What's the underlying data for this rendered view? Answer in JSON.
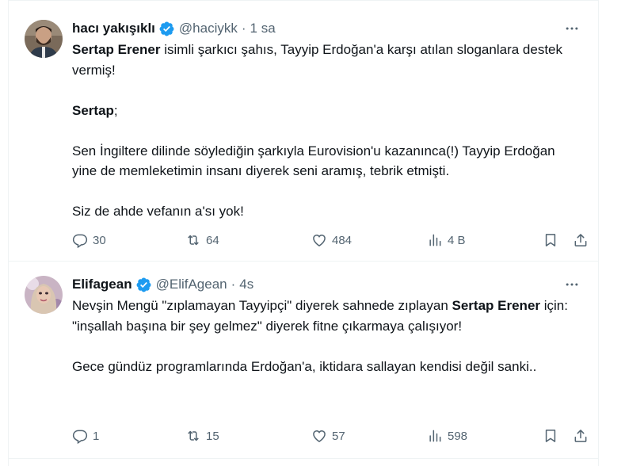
{
  "tweets": [
    {
      "author": {
        "display_name": "hacı yakışıklı",
        "handle": "@haciykk",
        "time": "1 sa",
        "verified": true
      },
      "body": {
        "p1_bold": "Sertap Erener",
        "p1_rest": " isimli şarkıcı şahıs, Tayyip Erdoğan'a karşı atılan sloganlara destek vermiş!",
        "p2_bold": "Sertap",
        "p2_rest": ";",
        "p3": "Sen İngiltere dilinde söylediğin şarkıyla Eurovision'u kazanınca(!) Tayyip Erdoğan yine de memleketimin insanı diyerek seni aramış, tebrik etmişti.",
        "p4": "Siz de ahde vefanın a'sı yok!"
      },
      "stats": {
        "replies": "30",
        "retweets": "64",
        "likes": "484",
        "views": "4 B"
      }
    },
    {
      "author": {
        "display_name": "Elifagean",
        "handle": "@ElifAgean",
        "time": "4s",
        "verified": true
      },
      "body": {
        "p1_pre": "Nevşin Mengü \"zıplamayan Tayyipçi\" diyerek sahnede zıplayan ",
        "p1_bold": "Sertap Erener",
        "p1_rest": " için:",
        "p2": "\"inşallah başına bir şey gelmez\" diyerek fitne çıkarmaya çalışıyor!",
        "p3": "Gece gündüz programlarında Erdoğan'a, iktidara sallayan kendisi değil sanki.."
      },
      "stats": {
        "replies": "1",
        "retweets": "15",
        "likes": "57",
        "views": "598"
      }
    }
  ],
  "icons": {
    "verified": "verified-badge-icon",
    "more": "more-icon",
    "reply": "reply-icon",
    "retweet": "retweet-icon",
    "like": "like-icon",
    "views": "views-icon",
    "bookmark": "bookmark-icon",
    "share": "share-icon"
  },
  "colors": {
    "verified": "#1d9bf0",
    "text": "#0f1419",
    "muted": "#536471",
    "border": "#eff3f4"
  }
}
